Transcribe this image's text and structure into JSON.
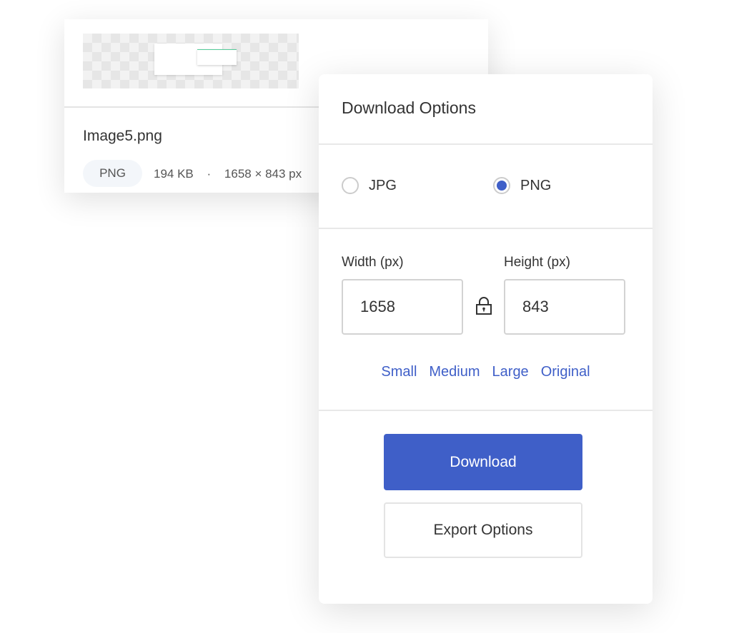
{
  "file_card": {
    "filename": "Image5.png",
    "format_badge": "PNG",
    "size": "194 KB",
    "separator": "·",
    "dimensions": "1658 × 843 px"
  },
  "dialog": {
    "title": "Download Options",
    "formats": [
      {
        "label": "JPG",
        "selected": false
      },
      {
        "label": "PNG",
        "selected": true
      }
    ],
    "width_label": "Width (px)",
    "height_label": "Height (px)",
    "width_value": "1658",
    "height_value": "843",
    "lock_icon": "lock-icon",
    "presets": [
      "Small",
      "Medium",
      "Large",
      "Original"
    ],
    "download_label": "Download",
    "export_label": "Export Options",
    "accent_color": "#3f5fc8"
  }
}
